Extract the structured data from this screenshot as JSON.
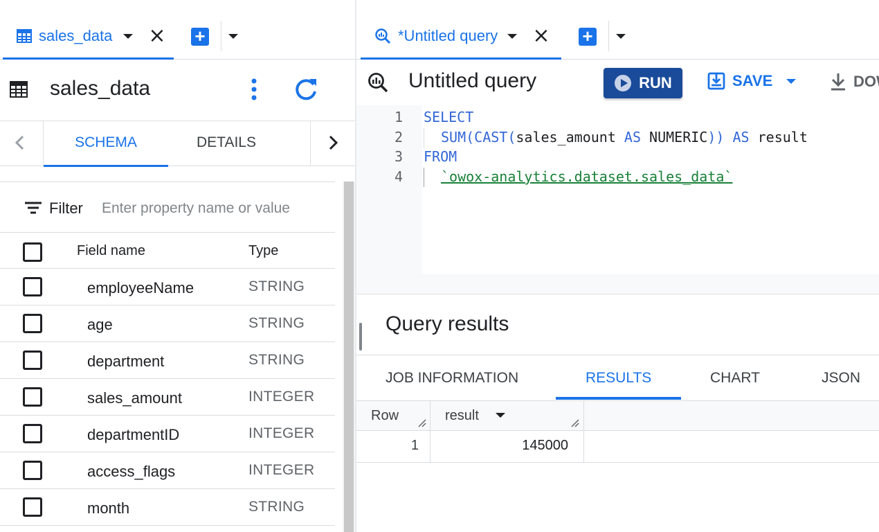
{
  "left_pane": {
    "tab": {
      "label": "sales_data"
    },
    "header": {
      "title": "sales_data"
    },
    "subtabs": [
      "SCHEMA",
      "DETAILS"
    ],
    "filter": {
      "label": "Filter",
      "placeholder": "Enter property name or value"
    },
    "schema_table": {
      "headers": {
        "field_name": "Field name",
        "type": "Type"
      },
      "rows": [
        {
          "name": "employeeName",
          "type": "STRING"
        },
        {
          "name": "age",
          "type": "STRING"
        },
        {
          "name": "department",
          "type": "STRING"
        },
        {
          "name": "sales_amount",
          "type": "INTEGER"
        },
        {
          "name": "departmentID",
          "type": "INTEGER"
        },
        {
          "name": "access_flags",
          "type": "INTEGER"
        },
        {
          "name": "month",
          "type": "STRING"
        }
      ]
    }
  },
  "right_pane": {
    "tab": {
      "label": "*Untitled query"
    },
    "toolbar": {
      "title": "Untitled query",
      "run_label": "RUN",
      "save_label": "SAVE",
      "download_label": "DOW"
    },
    "editor": {
      "line_numbers": [
        "1",
        "2",
        "3",
        "4"
      ],
      "lines": {
        "l1_kw": "SELECT",
        "l2_fn": "SUM(CAST(",
        "l2_col": "sales_amount",
        "l2_as1": " AS ",
        "l2_type": "NUMERIC",
        "l2_close": "))",
        "l2_as2": " AS ",
        "l2_alias": "result",
        "l3_kw": "FROM",
        "l4_table": "`owox-analytics.dataset.sales_data`"
      }
    },
    "results": {
      "title": "Query results",
      "tabs": [
        "JOB INFORMATION",
        "RESULTS",
        "CHART",
        "JSON"
      ],
      "active_tab": "RESULTS",
      "columns": [
        "Row",
        "result"
      ],
      "rows": [
        {
          "row": "1",
          "result": "145000"
        }
      ]
    }
  },
  "colors": {
    "accent": "#1a73e8",
    "run_button": "#1a4b9a",
    "keyword": "#3367d6",
    "string": "#188038"
  },
  "icons": {
    "table": "table-icon",
    "kebab": "more-vert-icon",
    "refresh": "refresh-icon",
    "query": "query-icon",
    "play": "play-icon",
    "save": "save-icon",
    "download": "download-icon",
    "filter": "filter-icon"
  }
}
